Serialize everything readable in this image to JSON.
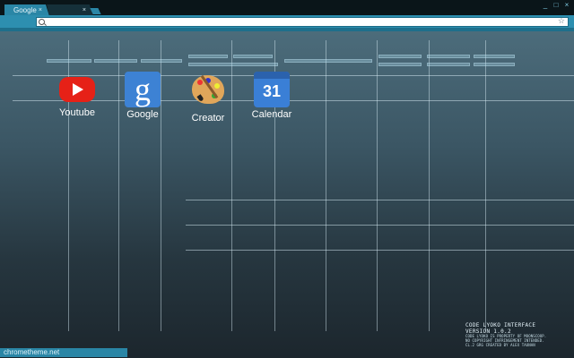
{
  "tabs": [
    {
      "label": "Google",
      "close": "×"
    },
    {
      "label": "",
      "close": "×"
    }
  ],
  "window_controls": {
    "minimize": "_",
    "maximize": "□",
    "close": "×"
  },
  "omnibox": {
    "value": "",
    "star": "☆"
  },
  "apps": [
    {
      "label": "Youtube",
      "icon": "youtube-icon"
    },
    {
      "label": "Google",
      "icon": "google-icon",
      "glyph": "g"
    },
    {
      "label": "Creator",
      "icon": "palette-icon"
    },
    {
      "label": "Calendar",
      "icon": "calendar-icon",
      "glyph": "31"
    }
  ],
  "credits": {
    "line1": "CODE LYOKO INTERFACE",
    "line2": "VERSION 1.0.2",
    "line3": "CODE LYOKO IS PROPERTY OF MOONSCOOP.",
    "line4": "NO COPYRIGHT INFRINGEMENT INTENDED.",
    "line5": "CL.2 GRG CREATED BY ALEX TAUNAN"
  },
  "status_text": "chrometheme.net",
  "colors": {
    "accent": "#2a86a6",
    "toolbar": "#2d8fb0",
    "youtube_red": "#e62117",
    "google_blue": "#3d82d4"
  }
}
